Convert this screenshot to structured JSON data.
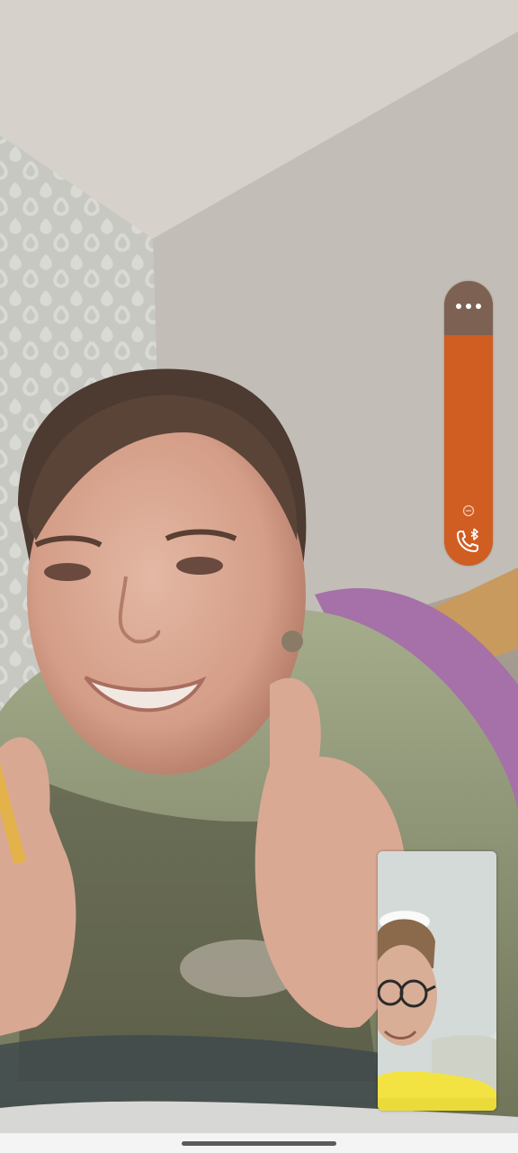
{
  "call": {
    "remote_video": "remote-participant-video",
    "self_video": "local-camera-preview"
  },
  "controls": {
    "more_icon": "more-horizontal-icon",
    "mute_icon": "minus-circle-icon",
    "call_icon": "phone-bluetooth-icon"
  },
  "colors": {
    "pill_accent": "#d05d22",
    "pill_top": "#7d6253",
    "nav_bar": "#f4f4f4"
  }
}
